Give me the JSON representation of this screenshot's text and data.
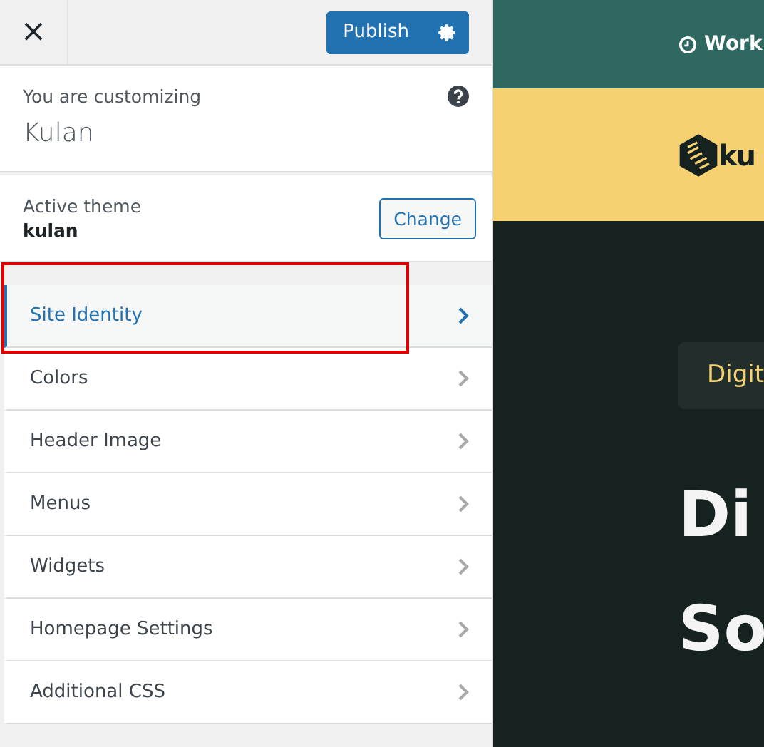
{
  "header": {
    "close": "×",
    "publish": "Publish"
  },
  "info": {
    "label": "You are customizing",
    "site": "Kulan"
  },
  "theme": {
    "label": "Active theme",
    "name": "kulan",
    "button": "Change"
  },
  "sections": [
    {
      "label": "Site Identity",
      "selected": true,
      "highlighted": true
    },
    {
      "label": "Colors",
      "selected": false,
      "highlighted": false
    },
    {
      "label": "Header Image",
      "selected": false,
      "highlighted": false
    },
    {
      "label": "Menus",
      "selected": false,
      "highlighted": false
    },
    {
      "label": "Widgets",
      "selected": false,
      "highlighted": false
    },
    {
      "label": "Homepage Settings",
      "selected": false,
      "highlighted": false
    },
    {
      "label": "Additional CSS",
      "selected": false,
      "highlighted": false
    }
  ],
  "preview": {
    "topbar": "Work",
    "logo": "ku",
    "badge": "Digit",
    "headline": [
      "Di",
      "So"
    ]
  }
}
